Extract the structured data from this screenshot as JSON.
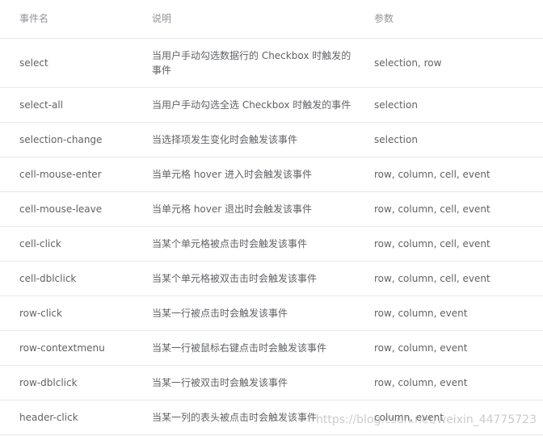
{
  "table": {
    "headers": {
      "name": "事件名",
      "description": "说明",
      "params": "参数"
    },
    "rows": [
      {
        "name": "select",
        "description": "当用户手动勾选数据行的 Checkbox 时触发的事件",
        "params": "selection, row"
      },
      {
        "name": "select-all",
        "description": "当用户手动勾选全选 Checkbox 时触发的事件",
        "params": "selection"
      },
      {
        "name": "selection-change",
        "description": "当选择项发生变化时会触发该事件",
        "params": "selection"
      },
      {
        "name": "cell-mouse-enter",
        "description": "当单元格 hover 进入时会触发该事件",
        "params": "row, column, cell, event"
      },
      {
        "name": "cell-mouse-leave",
        "description": "当单元格 hover 退出时会触发该事件",
        "params": "row, column, cell, event"
      },
      {
        "name": "cell-click",
        "description": "当某个单元格被点击时会触发该事件",
        "params": "row, column, cell, event"
      },
      {
        "name": "cell-dblclick",
        "description": "当某个单元格被双击击时会触发该事件",
        "params": "row, column, cell, event"
      },
      {
        "name": "row-click",
        "description": "当某一行被点击时会触发该事件",
        "params": "row, column, event"
      },
      {
        "name": "row-contextmenu",
        "description": "当某一行被鼠标右键点击时会触发该事件",
        "params": "row, column, event"
      },
      {
        "name": "row-dblclick",
        "description": "当某一行被双击时会触发该事件",
        "params": "row, column, event"
      },
      {
        "name": "header-click",
        "description": "当某一列的表头被点击时会触发该事件",
        "params": "column, event"
      }
    ]
  },
  "watermark": "https://blog.csdn.net/weixin_44775723"
}
